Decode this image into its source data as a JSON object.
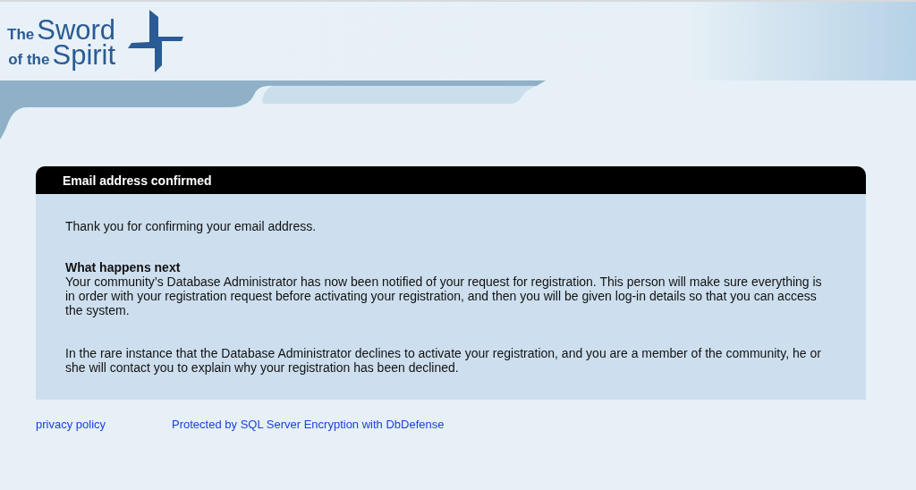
{
  "logo": {
    "line_1_small": "The",
    "line_1_large": "Sword",
    "line_2_small": "of the",
    "line_2_large": "Spirit"
  },
  "panel": {
    "title": "Email address confirmed",
    "intro": "Thank you for confirming your email address.",
    "heading": "What happens next",
    "paragraphs": [
      "Your community’s Database Administrator has now been notified of your request for registration. This person will make sure everything is in order with your registration request before activating your registration, and then you will be given log-in details so that you can access the system.",
      "In the rare instance that the Database Administrator declines to activate your registration, and you are a member of the community, he or she will contact you to explain why your registration has been declined."
    ]
  },
  "footer_links": [
    "privacy policy",
    "Protected by SQL Server Encryption with DbDefense"
  ]
}
